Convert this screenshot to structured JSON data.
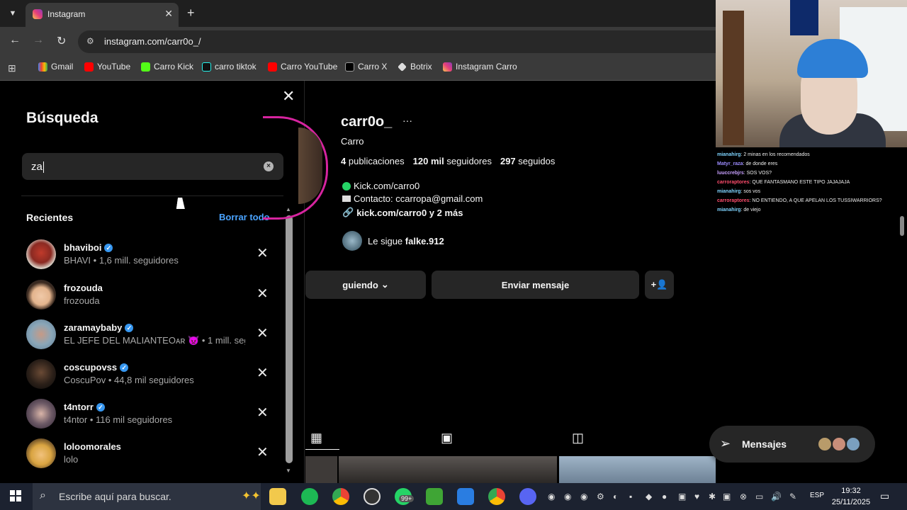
{
  "browser": {
    "tab_title": "Instagram",
    "url": "instagram.com/carr0o_/",
    "bookmarks": [
      "Gmail",
      "YouTube",
      "Carro Kick",
      "carro tiktok",
      "Carro YouTube",
      "Carro X",
      "Botrix",
      "Instagram Carro"
    ]
  },
  "search": {
    "title": "Búsqueda",
    "value": "za",
    "recent_label": "Recientes",
    "clear_all_label": "Borrar todo",
    "items": [
      {
        "name": "bhaviboi",
        "sub": "BHAVI • 1,6 mill. seguidores",
        "verified": true
      },
      {
        "name": "frozouda",
        "sub": "frozouda",
        "verified": false
      },
      {
        "name": "zaramaybaby",
        "sub": "EL JEFE DEL MALIANTEOᴀʀ 👿 • 1 mill. seguidores",
        "verified": true
      },
      {
        "name": "coscupovss",
        "sub": "CoscuPov • 44,8 mil seguidores",
        "verified": true
      },
      {
        "name": "t4ntorr",
        "sub": "t4ntor • 116 mil seguidores",
        "verified": true
      },
      {
        "name": "loloomorales",
        "sub": "lolo",
        "verified": false
      }
    ]
  },
  "profile": {
    "username": "carr0o_",
    "more": "···",
    "full_name": "Carro",
    "posts": "4",
    "posts_label": "publicaciones",
    "followers": "120 mil",
    "followers_label": "seguidores",
    "following": "297",
    "following_label": "seguidos",
    "bio_line1": "Kick.com/carro0",
    "bio_line2": "Contacto: ccarropa@gmail.com",
    "bio_link": "kick.com/carro0 y 2 más",
    "followed_by_prefix": "Le sigue",
    "followed_by_user": "falke.912",
    "following_button": "guiendo",
    "message_button": "Enviar mensaje"
  },
  "chat": {
    "lines": [
      {
        "user": "mianahirg",
        "text": ": 2 minas en los recomendados",
        "color": "#7fd4ff"
      },
      {
        "user": "Matyr_raza",
        "text": ": de donde eres",
        "color": "#9d8cff"
      },
      {
        "user": "luuccrebjrs",
        "text": ": SOS VOS?",
        "color": "#c8a0ff"
      },
      {
        "user": "carroraptores",
        "text": ": QUE FANTASMANO ESTE TIPO JAJAJAJA",
        "color": "#ff4d6d"
      },
      {
        "user": "mianahirg",
        "text": ": sos vos",
        "color": "#7fd4ff"
      },
      {
        "user": "carroraptores",
        "text": ": NO ENTIENDO, A QUE APELAN LOS TUSSIWARRIORS?",
        "color": "#ff4d6d"
      },
      {
        "user": "mianahirg",
        "text": ": de viejo",
        "color": "#7fd4ff"
      }
    ]
  },
  "messages": {
    "label": "Mensajes"
  },
  "taskbar": {
    "search_placeholder": "Escribe aquí para buscar.",
    "badge": "99+",
    "lang": "ESP",
    "time": "19:32",
    "date": "25/11/2025"
  }
}
